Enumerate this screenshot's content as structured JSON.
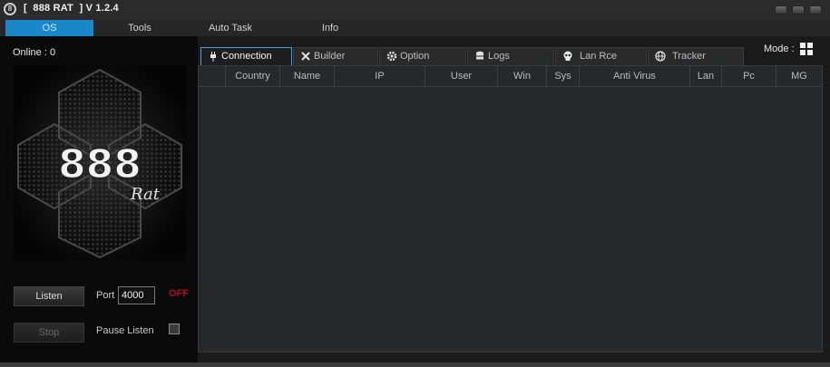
{
  "window": {
    "title": "[  888 RAT  ] V 1.2.4",
    "icon": "app-logo-icon"
  },
  "menu": {
    "items": [
      {
        "label": "OS",
        "active": true
      },
      {
        "label": "Tools"
      },
      {
        "label": "Auto Task"
      },
      {
        "label": "Info"
      }
    ]
  },
  "side": {
    "online_label": "Online : 0",
    "logo_number": "888",
    "logo_script": "Rat",
    "listen_label": "Listen",
    "stop_label": "Stop",
    "port_label": "Port",
    "port_value": "4000",
    "status_text": "OFF",
    "pause_label": "Pause Listen"
  },
  "mode": {
    "label": "Mode :",
    "icon": "windows-icon"
  },
  "tabs": [
    {
      "label": "Connection",
      "icon": "plug-icon",
      "active": true
    },
    {
      "label": "Builder",
      "icon": "tools-icon"
    },
    {
      "label": "Option",
      "icon": "gear-icon"
    },
    {
      "label": "Logs",
      "icon": "database-icon"
    },
    {
      "label": "Lan Rce",
      "icon": "skull-icon"
    },
    {
      "label": "Tracker",
      "icon": "globe-icon"
    }
  ],
  "grid": {
    "columns": [
      "",
      "Country",
      "Name",
      "IP",
      "User",
      "Win",
      "Sys",
      "Anti Virus",
      "Lan",
      "Pc",
      "MG"
    ]
  },
  "colors": {
    "accent": "#1a88c8",
    "status_off": "#b01010"
  }
}
